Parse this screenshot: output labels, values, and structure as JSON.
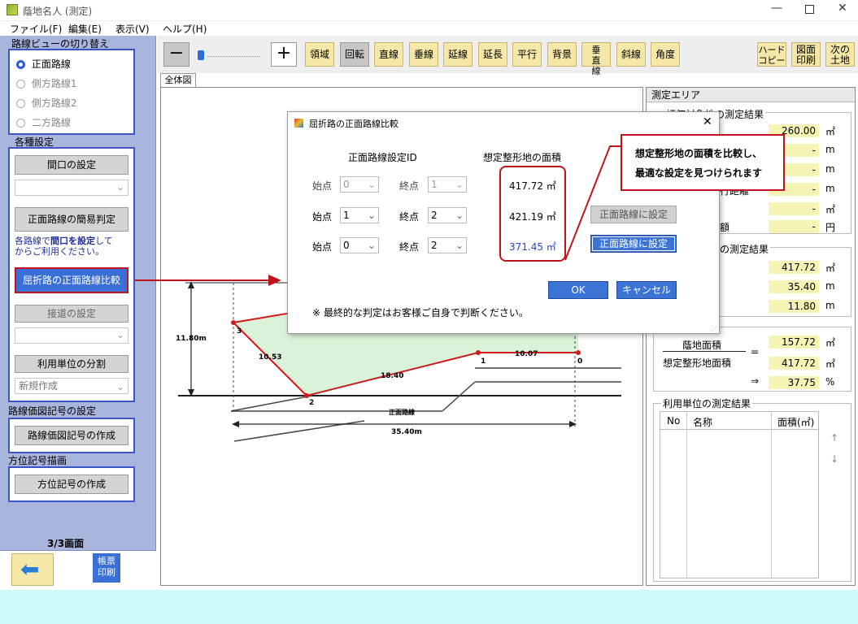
{
  "window": {
    "title": "蔭地名人 (測定)"
  },
  "menu": [
    "ファイル(F)",
    "編集(E)",
    "表示(V)",
    "ヘルプ(H)"
  ],
  "left": {
    "route_view_title": "路線ビューの切り替え",
    "route_options": [
      "正面路線",
      "側方路線1",
      "側方路線2",
      "二方路線"
    ],
    "settings_title": "各種設定",
    "frontage_btn": "間口の設定",
    "simple_judge_btn": "正面路線の簡易判定",
    "note_line1": "各路線で",
    "note_bold": "間口を設定",
    "note_line1b": "して",
    "note_line2": "からご利用ください。",
    "bent_road_btn": "屈折路の正面路線比較",
    "access_btn": "接道の設定",
    "unit_split_btn": "利用単位の分割",
    "new_create": "新規作成",
    "price_title": "路線価図記号の設定",
    "price_btn": "路線価図記号の作成",
    "direction_title": "方位記号描画",
    "direction_btn": "方位記号の作成",
    "page_indicator": "3/3画面",
    "print_label": "帳票印刷"
  },
  "toolbar": {
    "minus": "−",
    "plus": "+",
    "buttons": [
      "領域",
      "回転",
      "直線",
      "垂線",
      "延線",
      "延長",
      "平行",
      "背景",
      "垂直線",
      "斜線",
      "角度"
    ],
    "hardcopy": "ハード\nコピー",
    "print_drawing": "図面\n印刷",
    "next_land": "次の\n土地"
  },
  "tab": "全体図",
  "drawing": {
    "lbl_1180": "11.80m",
    "lbl_1053": "10.53",
    "lbl_1840": "18.40",
    "lbl_1007": "10.07",
    "pt0": "0",
    "pt1": "1",
    "pt2": "2",
    "pt3": "3",
    "road_label": "正面路線",
    "lbl_3540": "35.40m"
  },
  "right": {
    "area_title": "測定エリア",
    "sec1_title": "評価対象地の測定結果",
    "sec1_vals": [
      "260.00",
      "-",
      "-",
      "-",
      "-",
      "-"
    ],
    "sec1_units": [
      "㎡",
      "m",
      "m",
      "m",
      "㎡",
      "円"
    ],
    "row_label_4": "奥行距離",
    "row_label_6": "価額",
    "sec2_title": "の測定結果",
    "sec2_vals": [
      "417.72",
      "35.40",
      "11.80"
    ],
    "sec2_units": [
      "㎡",
      "m",
      "m"
    ],
    "shade_area_label": "蔭地面積",
    "shade_area_val": "157.72",
    "assumed_label": "想定整形地面積",
    "assumed_val": "417.72",
    "eq": "=",
    "arrow": "⇒",
    "ratio": "37.75",
    "unit_sqm": "㎡",
    "unit_pct": "%",
    "sec4_title": "利用単位の測定結果",
    "col_no": "No",
    "col_name": "名称",
    "col_area": "面積(㎡)",
    "up": "↑",
    "down": "↓"
  },
  "dialog": {
    "title": "屈折路の正面路線比較",
    "col1": "正面路線設定ID",
    "col2": "想定整形地の面積",
    "start": "始点",
    "end": "終点",
    "rows": [
      {
        "start": "0",
        "end": "1",
        "area": "417.72 ㎡",
        "btn": ""
      },
      {
        "start": "1",
        "end": "2",
        "area": "421.19 ㎡",
        "btn": "正面路線に設定"
      },
      {
        "start": "0",
        "end": "2",
        "area": "371.45 ㎡",
        "btn": "正面路線に設定"
      }
    ],
    "ok": "OK",
    "cancel": "キャンセル",
    "note": "※ 最終的な判定はお客様ご自身で判断ください。",
    "close": "✕"
  },
  "callout": {
    "line1": "想定整形地の面積を比較し、",
    "line2": "最適な設定を見つけられます"
  },
  "colors": {
    "accent": "#3a55c7",
    "highlight": "#c0141c",
    "button_blue": "#3c74d6"
  }
}
